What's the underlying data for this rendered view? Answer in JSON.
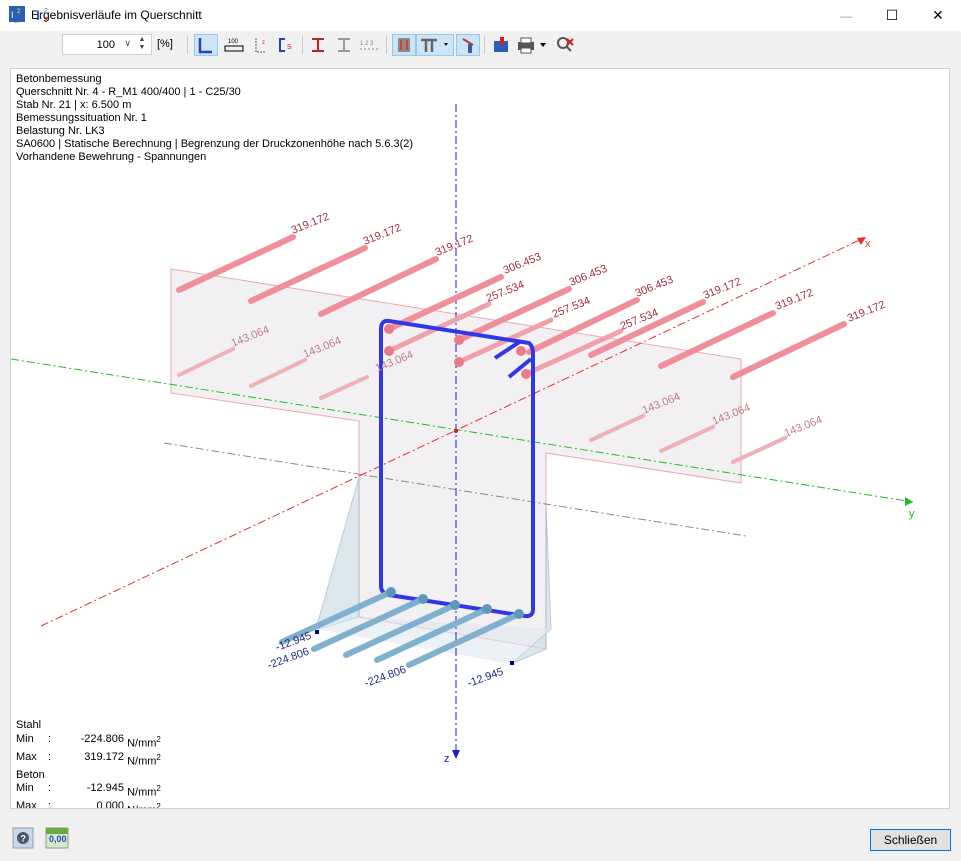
{
  "window": {
    "title": "Ergebnisverläufe im Querschnitt",
    "minimize_symbol": "—",
    "maximize_symbol": "☐",
    "close_symbol": "✕"
  },
  "toolbar": {
    "zoom_value": "100",
    "zoom_unit": "[%]",
    "buttons": [
      "section-results-icon",
      "reinforcement-results-icon",
      "section-view-icon",
      "dimension-100-icon",
      "stress-points-icon",
      "frame-icon",
      "beam-icon",
      "beam-gray-icon",
      "numbering-icon",
      "show-rebar-icon",
      "tee-section-icon",
      "cut-icon",
      "export-icon",
      "print-icon",
      "reset-icon"
    ]
  },
  "info": {
    "line1": "Betonbemessung",
    "line2": "Querschnitt Nr. 4 - R_M1 400/400 | 1 - C25/30",
    "line3": "Stab Nr. 21 | x: 6.500 m",
    "line4": "Bemessungssituation Nr. 1",
    "line5": "Belastung Nr. LK3",
    "line6": "SA0600 | Statische Berechnung | Begrenzung der Druckzonenhöhe nach 5.6.3(2)",
    "line7": "Vorhandene Bewehrung - Spannungen"
  },
  "diagram": {
    "axes": {
      "x": "x",
      "y": "y",
      "z": "z"
    },
    "tension_labels": {
      "top_outer": "319.172",
      "top_mid": "306.453",
      "top_inner": "257.534",
      "slab_bottom": "143.064"
    },
    "compression_labels": {
      "steel_min": "-224.806",
      "concrete_min": "-12.945"
    },
    "colors": {
      "tension": "#e8808c",
      "compression": "#7fb1cf",
      "stirrup": "#2f37e6",
      "x_axis": "#e03030",
      "y_axis": "#22bb22",
      "z_axis": "#1a1acc"
    }
  },
  "summary": {
    "steel_title": "Stahl",
    "steel_min_key": "Min",
    "steel_min": "-224.806",
    "steel_max_key": "Max",
    "steel_max": "319.172",
    "concrete_title": "Beton",
    "concrete_min_key": "Min",
    "concrete_min": "-12.945",
    "concrete_max_key": "Max",
    "concrete_max": "0.000",
    "unit": "N/mm",
    "unit_exp": "2",
    "colon": ":"
  },
  "footer": {
    "close_label": "Schließen",
    "decimals_label": "0,00"
  }
}
